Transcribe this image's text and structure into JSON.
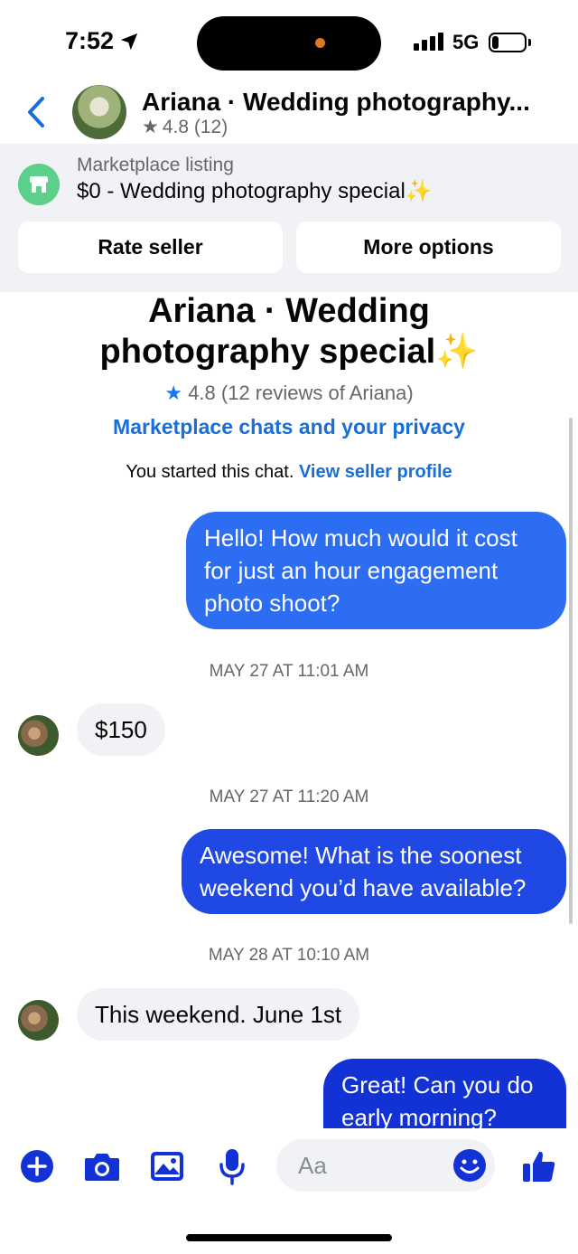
{
  "status_bar": {
    "time": "7:52",
    "network": "5G",
    "battery_level": 0.2
  },
  "header": {
    "title": "Ariana · Wedding photography...",
    "rating": "4.8 (12)"
  },
  "listing": {
    "label": "Marketplace listing",
    "title": "$0 - Wedding photography special",
    "rate_button": "Rate seller",
    "more_button": "More options"
  },
  "intro": {
    "title_line1": "Ariana · Wedding",
    "title_line2": "photography special",
    "rating": "4.8 (12 reviews of Ariana)",
    "privacy_link": "Marketplace chats and your privacy",
    "started_text": "You started this chat.",
    "profile_link": "View seller profile"
  },
  "messages": [
    {
      "direction": "out",
      "text": "Hello! How much would it cost for just an hour engagement photo shoot?"
    },
    {
      "direction": "in",
      "text": "$150"
    },
    {
      "direction": "out",
      "text": "Awesome! What is the soonest weekend you’d have available?"
    },
    {
      "direction": "in",
      "text": "This weekend. June 1st"
    },
    {
      "direction": "out",
      "text": "Great! Can you do early morning?"
    }
  ],
  "timestamps": [
    "MAY 27 AT 11:01 AM",
    "MAY 27 AT 11:20 AM",
    "MAY 28 AT 10:10 AM"
  ],
  "composer": {
    "placeholder": "Aa",
    "icons": [
      "plus-icon",
      "camera-icon",
      "image-icon",
      "microphone-icon",
      "emoji-icon",
      "thumbs-up-icon"
    ]
  },
  "colors": {
    "accent": "#1a6ed8",
    "bubble_1": "#2d6df2",
    "bubble_2": "#1f48e4",
    "bubble_3": "#1232d6",
    "incoming": "#f0f2f5",
    "marketplace_green": "#5cd08a"
  }
}
